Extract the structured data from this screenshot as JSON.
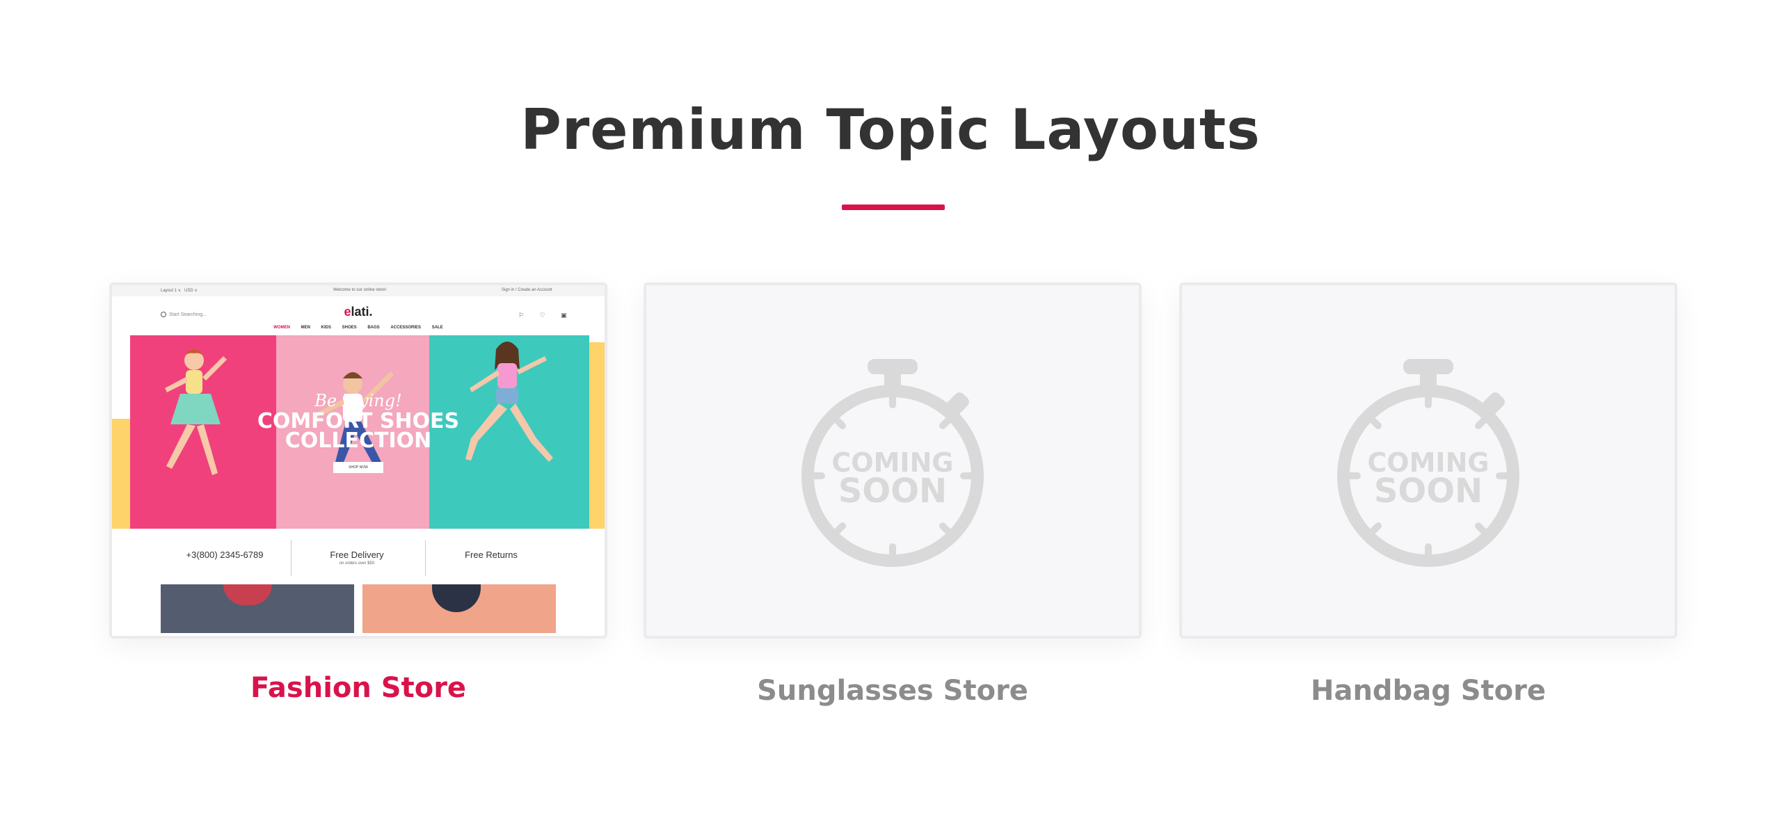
{
  "header": {
    "title": "Premium Topic Layouts",
    "accent_color": "#d9134a"
  },
  "cards": [
    {
      "label": "Fashion Store",
      "status": "available",
      "preview": {
        "topbar": {
          "language": "Layout 1 ∨",
          "currency": "USD ∨",
          "welcome": "Welcome to our online store!",
          "account": "Sign in / Create an Account"
        },
        "search_placeholder": "Start Searching...",
        "logo_accent": "e",
        "logo_rest": "lati.",
        "header_icons": "⚐ ♡ ▣",
        "nav": [
          "WOMEN",
          "MEN",
          "KIDS",
          "SHOES",
          "BAGS",
          "ACCESSORIES",
          "SALE"
        ],
        "nav_active": "WOMEN",
        "hero": {
          "script": "Be Flying!",
          "title_line1": "COMFORT SHOES",
          "title_line2": "COLLECTION",
          "button": "SHOP NOW"
        },
        "features": [
          {
            "title": "+3(800) 2345-6789",
            "sub": ""
          },
          {
            "title": "Free Delivery",
            "sub": "on orders over $50"
          },
          {
            "title": "Free Returns",
            "sub": ""
          }
        ]
      }
    },
    {
      "label": "Sunglasses Store",
      "status": "coming-soon",
      "placeholder_line1": "COMING",
      "placeholder_line2": "SOON"
    },
    {
      "label": "Handbag Store",
      "status": "coming-soon",
      "placeholder_line1": "COMING",
      "placeholder_line2": "SOON"
    }
  ],
  "colors": {
    "label_active": "#d9134a",
    "label_inactive": "#8c8c8c",
    "placeholder_gray": "#d9d9d9",
    "hero_pink": "#f0417d",
    "hero_light_pink": "#f4a7bd",
    "hero_teal": "#3ec9bd",
    "hero_yellow": "#fdd36a"
  },
  "icons": [
    "search-icon",
    "flag-icon",
    "heart-icon",
    "bag-icon",
    "stopwatch-icon"
  ]
}
